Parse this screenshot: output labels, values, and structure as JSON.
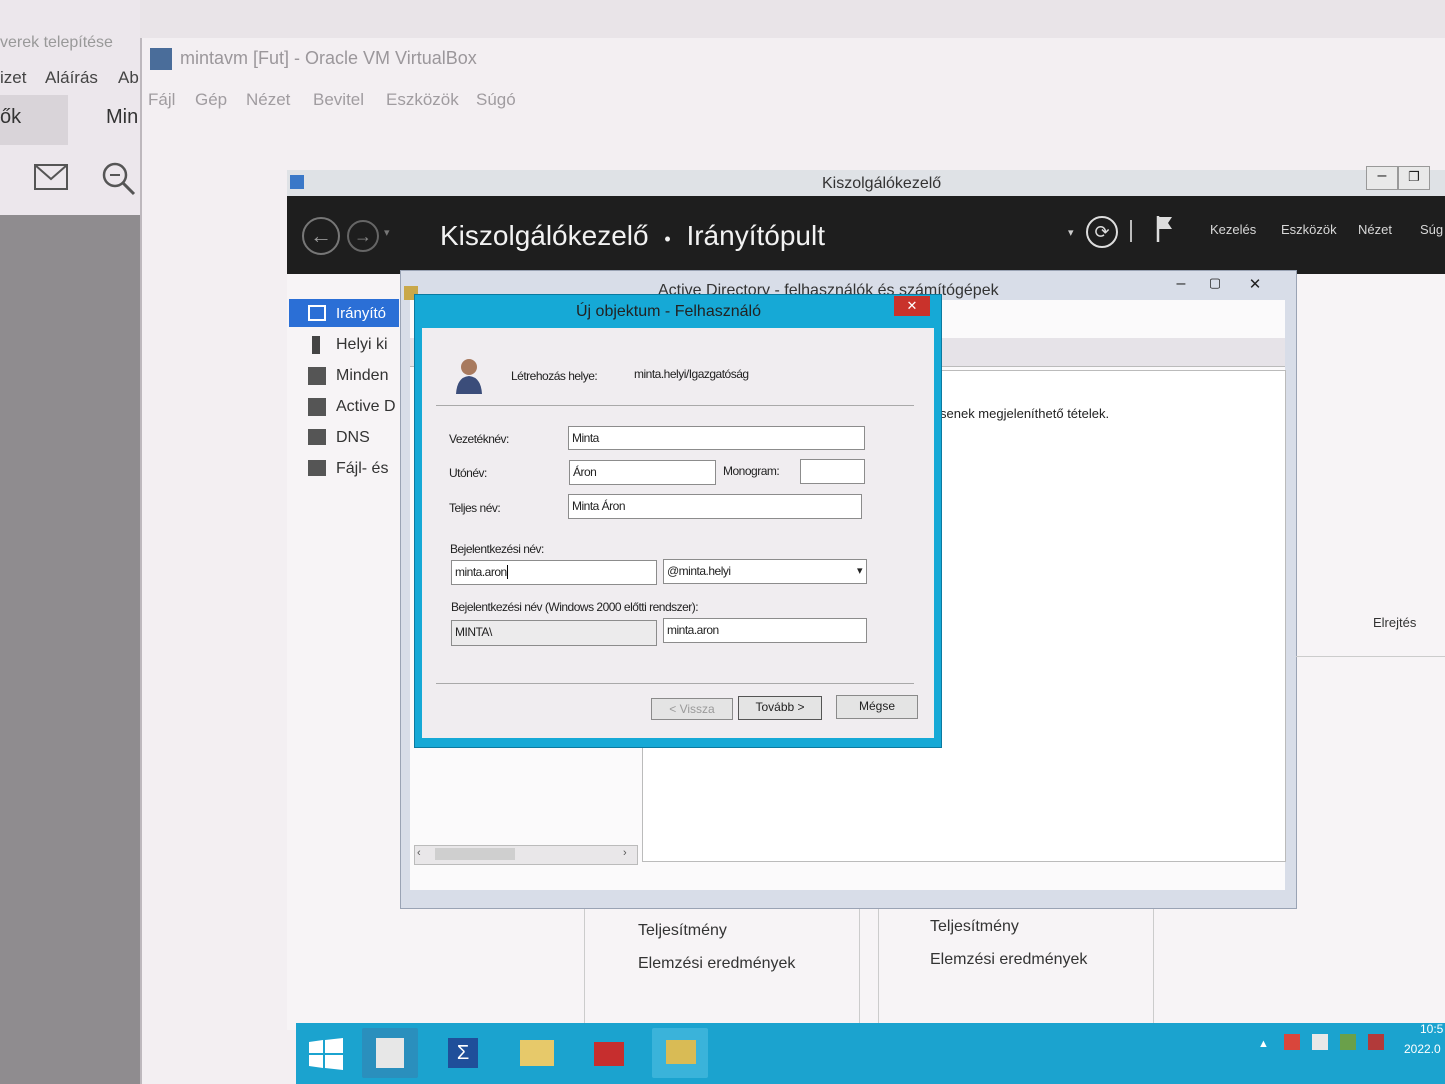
{
  "host": {
    "text_fragment": "verek telepítése",
    "menu": [
      "izet",
      "Aláírás",
      "Ab"
    ],
    "tabs": [
      "ők",
      "Min"
    ]
  },
  "vbox": {
    "title": "mintavm [Fut] - Oracle VM VirtualBox",
    "menu": [
      "Fájl",
      "Gép",
      "Nézet",
      "Bevitel",
      "Eszközök",
      "Súgó"
    ]
  },
  "server_manager": {
    "window_title": "Kiszolgálókezelő",
    "breadcrumb_root": "Kiszolgálókezelő",
    "breadcrumb_sep": "•",
    "breadcrumb_page": "Irányítópult",
    "menu": [
      "Kezelés",
      "Eszközök",
      "Nézet",
      "Súg"
    ],
    "nav": [
      "Irányító",
      "Helyi ki",
      "Minden",
      "Active D",
      "DNS",
      "Fájl- és"
    ],
    "tiles_left": [
      "Teljesítmény",
      "Elemzési eredmények"
    ],
    "tiles_right": [
      "Teljesítmény",
      "Elemzési eredmények"
    ]
  },
  "aduc": {
    "title": "Active Directory - felhasználók és számítógépek",
    "empty_text": "senek megjeleníthető tételek.",
    "side_label": "Elrejtés"
  },
  "dialog": {
    "title": "Új objektum - Felhasználó",
    "close_glyph": "✕",
    "create_in_label": "Létrehozás helye:",
    "create_in_value": "minta.helyi/Igazgatóság",
    "last_name_label": "Vezetéknév:",
    "last_name_value": "Minta",
    "first_name_label": "Utónév:",
    "first_name_value": "Áron",
    "initials_label": "Monogram:",
    "initials_value": "",
    "full_name_label": "Teljes név:",
    "full_name_value": "Minta Áron",
    "logon_label": "Bejelentkezési név:",
    "logon_value": "minta.aron",
    "domain_value": "@minta.helyi",
    "pre2000_label": "Bejelentkezési név (Windows 2000 előtti rendszer):",
    "pre2000_domain": "MINTA\\",
    "pre2000_value": "minta.aron",
    "btn_back": "< Vissza",
    "btn_next": "Tovább >",
    "btn_cancel": "Mégse"
  },
  "taskbar": {
    "time": "10:5",
    "date": "2022.0"
  },
  "colors": {
    "dialog_accent": "#16a9d6",
    "taskbar": "#1ba3cf",
    "nav_selected": "#2b6fd6",
    "close_button": "#c9322b"
  }
}
